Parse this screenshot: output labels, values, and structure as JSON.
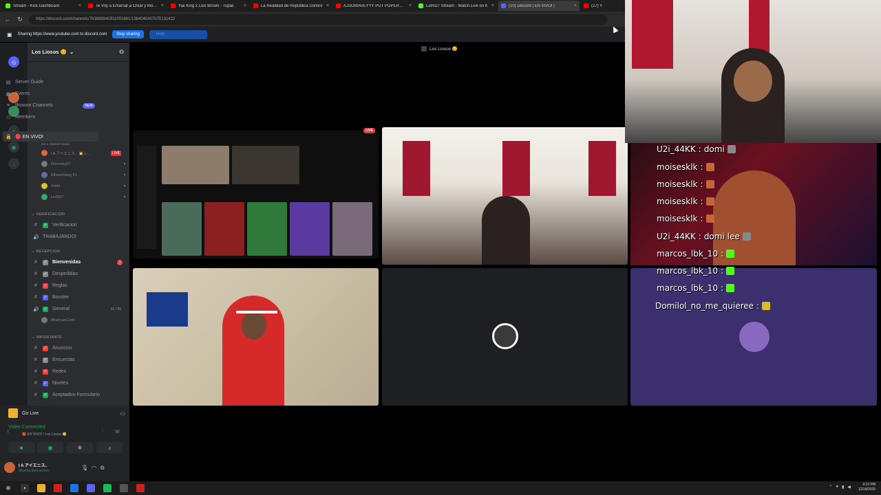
{
  "browser": {
    "tabs": [
      {
        "label": "Stream - Kick Dashboard",
        "color": "#53fc18"
      },
      {
        "label": "Te Voy a Enseñar a Crear y Monet",
        "color": "#ff0000"
      },
      {
        "label": "Yaii King x Luis Brown - Tupac",
        "color": "#ff0000"
      },
      {
        "label": "La Realidad de República Domini",
        "color": "#ff0000"
      },
      {
        "label": "AJSOWAVEYYY PUT POPEROLIN",
        "color": "#ff0000"
      },
      {
        "label": "LioRD7 Stream - Watch Live on K",
        "color": "#53fc18"
      },
      {
        "label": "(10) Discord | EN VIVO! |",
        "color": "#5865f2"
      },
      {
        "label": "(27) Y",
        "color": "#ff0000"
      }
    ],
    "url": "https://discord.com/channels/763898940911001681/1384040407075131422",
    "sharing_text": "Sharing https://www.youtube.com to discord.com",
    "stop_sharing": "Stop sharing",
    "hide_label": "Hide"
  },
  "discord": {
    "server_name": "Los Liosos 😊",
    "top_items": [
      {
        "label": "Server Guide",
        "icon": "book-icon"
      },
      {
        "label": "Events",
        "icon": "calendar-icon"
      },
      {
        "label": "Browse Channels",
        "icon": "channels-icon",
        "badge": "NEW"
      },
      {
        "label": "Members",
        "icon": "members-icon"
      }
    ],
    "voice_channel": {
      "label": "🔴 EN VIVO!",
      "status_placeholder": "Set a channel status",
      "users": [
        {
          "name": "I A アイエニス、💥 L...",
          "color": "#d96b3a",
          "live": "LIVE"
        },
        {
          "name": "Drmoney07",
          "color": "#7a7a7a"
        },
        {
          "name": "ElbossGang F1",
          "color": "#6a6aa0"
        },
        {
          "name": "Jodel",
          "color": "#d4c23a"
        },
        {
          "name": "LioRD7",
          "color": "#3aa86b"
        }
      ]
    },
    "categories": [
      {
        "label": "VERIFICACION",
        "channels": [
          {
            "label": "Verificacion",
            "icon": "#",
            "emoji_color": "#23a55a"
          },
          {
            "label": "TRABAJANDO!",
            "icon": "speaker"
          }
        ]
      },
      {
        "label": "RECEPCION",
        "channels": [
          {
            "label": "Bienvenidas",
            "icon": "#",
            "emoji_color": "#888",
            "bold": true,
            "badge": "1"
          },
          {
            "label": "Despedidas",
            "icon": "#",
            "emoji_color": "#888"
          },
          {
            "label": "Reglas",
            "icon": "#",
            "emoji_color": "#f23f42"
          },
          {
            "label": "Booster",
            "icon": "#",
            "emoji_color": "#5865f2"
          },
          {
            "label": "General",
            "icon": "speaker",
            "emoji_color": "#23a55a",
            "count": "01 / 99"
          }
        ]
      },
      {
        "label": "IMPORTANTE",
        "channels": [
          {
            "label": "Anuncios",
            "icon": "#",
            "emoji_color": "#f23f42"
          },
          {
            "label": "Encuestas",
            "icon": "#",
            "emoji_color": "#888"
          },
          {
            "label": "Redes",
            "icon": "#",
            "emoji_color": "#f23f42"
          },
          {
            "label": "Niveles",
            "icon": "#",
            "emoji_color": "#5865f2"
          },
          {
            "label": "Aceptados-Formulario",
            "icon": "#",
            "emoji_color": "#23a55a"
          }
        ]
      }
    ],
    "general_user": "IBrahyanCorH",
    "go_live": "Go Live",
    "video_connected": "Video Connected",
    "video_sub": "🔴 EN VIVO! / Los Liosos 😊",
    "self_name": "I A アイエニス、",
    "self_status": "Sharing their screen",
    "stage_title": "Los Liosos 😊",
    "live_tag": "LIVE"
  },
  "chat_overlay": {
    "lines": [
      {
        "user": "U2i_44KK",
        "msg": "domi",
        "chip": "#888"
      },
      {
        "user": "moisesklk",
        "msg": "",
        "chip": "#c7643a"
      },
      {
        "user": "moisesklk",
        "msg": "",
        "chip": "#c7643a"
      },
      {
        "user": "moisesklk",
        "msg": "",
        "chip": "#c7643a"
      },
      {
        "user": "moisesklk",
        "msg": "",
        "chip": "#c7643a"
      },
      {
        "user": "U2i_44KK",
        "msg": "domi lee",
        "chip": "#888"
      },
      {
        "user": "marcos_lbk_10",
        "msg": "",
        "chip": "#53fc18"
      },
      {
        "user": "marcos_lbk_10",
        "msg": "",
        "chip": "#53fc18"
      },
      {
        "user": "marcos_lbk_10",
        "msg": "",
        "chip": "#53fc18"
      },
      {
        "user": "Domilol_no_me_quieree",
        "msg": "",
        "chip": "#d8c020"
      }
    ]
  },
  "taskbar": {
    "time": "9:10 PM",
    "date": "12/18/2025"
  }
}
